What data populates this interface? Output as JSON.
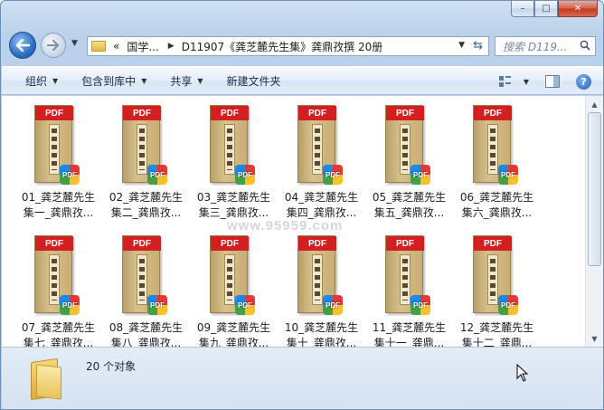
{
  "window": {
    "minimize_label": "–",
    "maximize_label": "□",
    "close_label": "✕"
  },
  "nav": {
    "back_icon": "back-arrow-icon",
    "forward_icon": "forward-arrow-icon",
    "breadcrumb": {
      "overflow": "«",
      "root": "国学...",
      "current": "D11907《龚芝麓先生集》龚鼎孜撰 20册"
    },
    "search_placeholder": "搜索 D119..."
  },
  "toolbar": {
    "organize": "组织",
    "include_in_library": "包含到库中",
    "share": "共享",
    "new_folder": "新建文件夹",
    "help": "?"
  },
  "files": [
    {
      "line1": "01_龚芝麓先生",
      "line2": "集一_龚鼎孜..."
    },
    {
      "line1": "02_龚芝麓先生",
      "line2": "集二_龚鼎孜..."
    },
    {
      "line1": "03_龚芝麓先生",
      "line2": "集三_龚鼎孜..."
    },
    {
      "line1": "04_龚芝麓先生",
      "line2": "集四_龚鼎孜..."
    },
    {
      "line1": "05_龚芝麓先生",
      "line2": "集五_龚鼎孜..."
    },
    {
      "line1": "06_龚芝麓先生",
      "line2": "集六_龚鼎孜..."
    },
    {
      "line1": "07_龚芝麓先生",
      "line2": "集七_龚鼎孜..."
    },
    {
      "line1": "08_龚芝麓先生",
      "line2": "集八_龚鼎孜..."
    },
    {
      "line1": "09_龚芝麓先生",
      "line2": "集九_龚鼎孜..."
    },
    {
      "line1": "10_龚芝麓先生",
      "line2": "集十_龚鼎孜..."
    },
    {
      "line1": "11_龚芝麓先生",
      "line2": "集十一_龚鼎..."
    },
    {
      "line1": "12_龚芝麓先生",
      "line2": "集十二_龚鼎..."
    }
  ],
  "thumbnail": {
    "band_text": "PDF",
    "badge_text": "PDF"
  },
  "watermark": "www.95959.com",
  "status": {
    "count_text": "20 个对象"
  }
}
